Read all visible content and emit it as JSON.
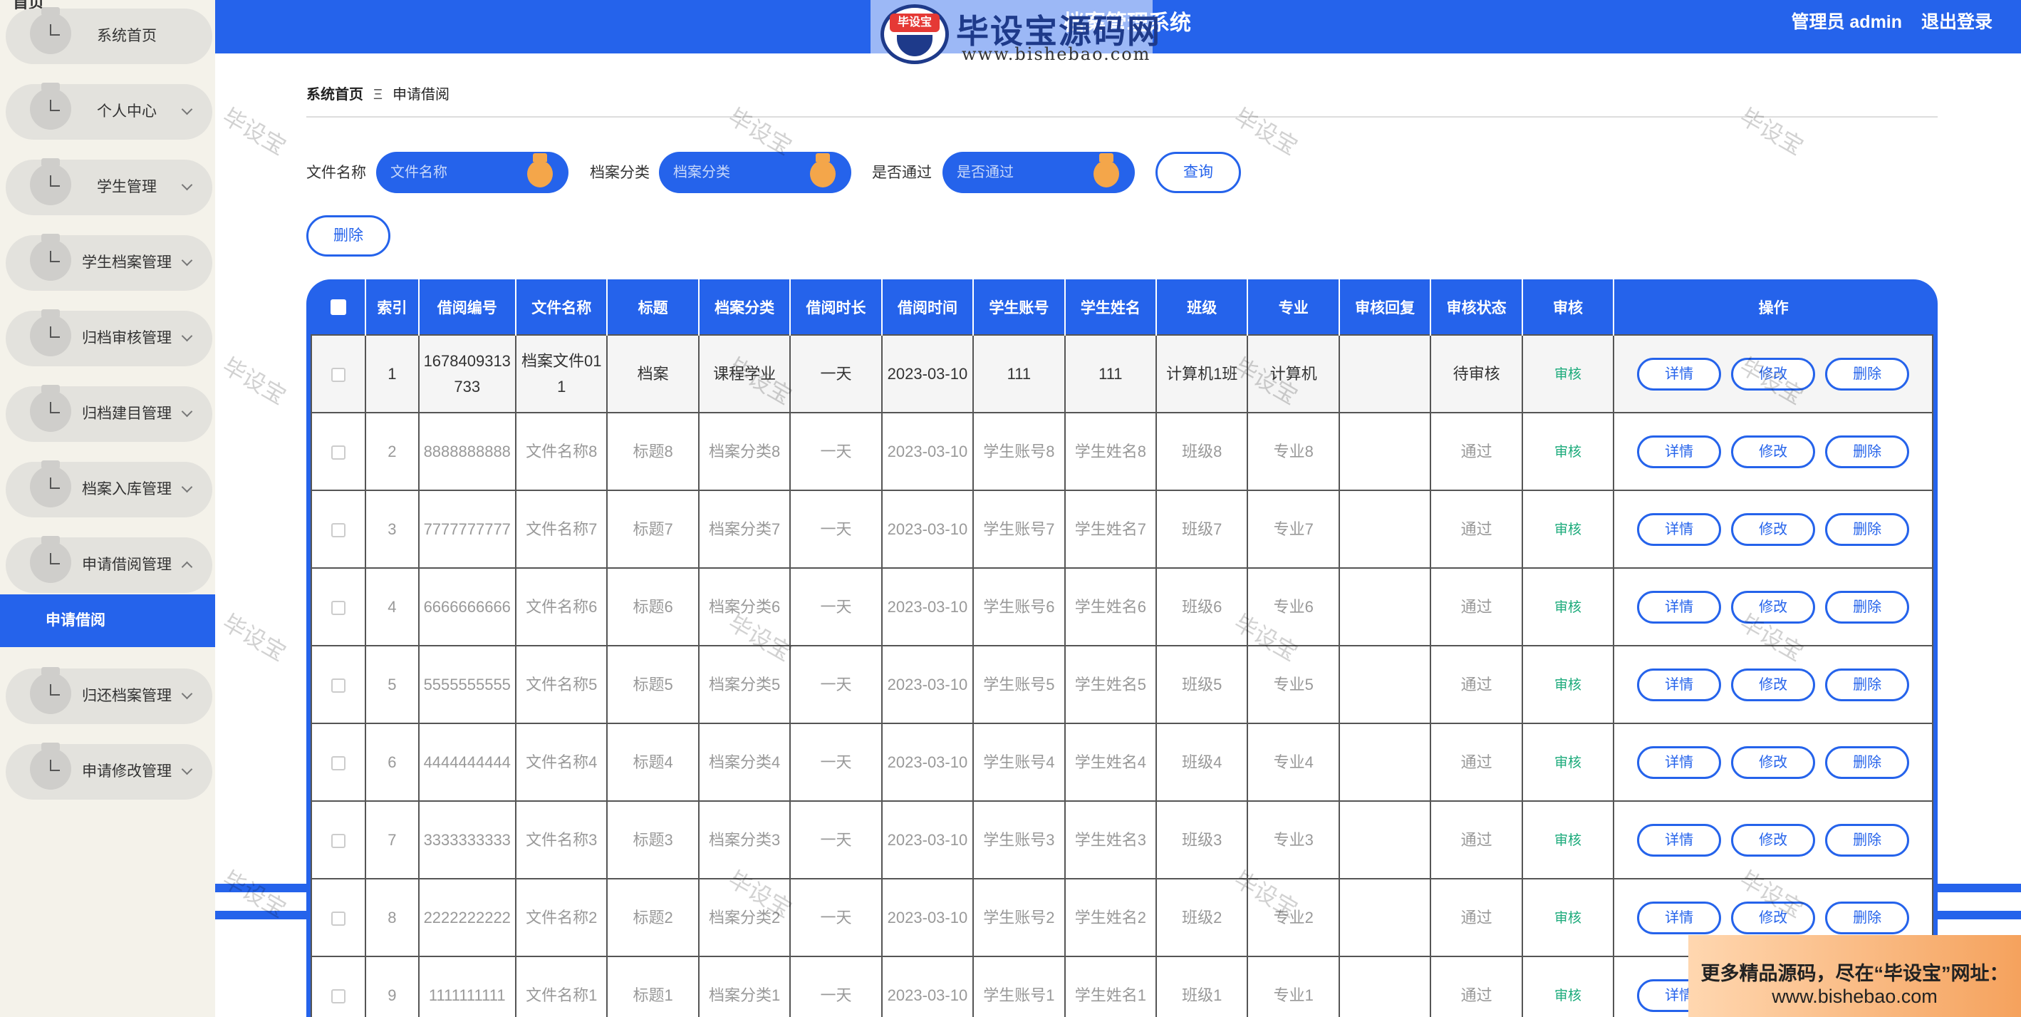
{
  "header": {
    "title": "档案管理系统",
    "user": "管理员 admin",
    "logout": "退出登录"
  },
  "sidebar": {
    "top_text": "首页",
    "items": [
      {
        "label": "系统首页",
        "has_children": false
      },
      {
        "label": "个人中心",
        "has_children": true
      },
      {
        "label": "学生管理",
        "has_children": true
      },
      {
        "label": "学生档案管理",
        "has_children": true
      },
      {
        "label": "归档审核管理",
        "has_children": true
      },
      {
        "label": "归档建目管理",
        "has_children": true
      },
      {
        "label": "档案入库管理",
        "has_children": true
      },
      {
        "label": "申请借阅管理",
        "has_children": true,
        "expanded": true
      },
      {
        "label": "归还档案管理",
        "has_children": true
      },
      {
        "label": "申请修改管理",
        "has_children": true
      }
    ],
    "active_sub": "申请借阅"
  },
  "breadcrumb": {
    "home": "系统首页",
    "sep": "Ξ",
    "current": "申请借阅"
  },
  "search": {
    "file_name_label": "文件名称",
    "file_name_placeholder": "文件名称",
    "category_label": "档案分类",
    "category_placeholder": "档案分类",
    "pass_label": "是否通过",
    "pass_placeholder": "是否通过",
    "query_button": "查询",
    "delete_button": "删除"
  },
  "table": {
    "columns": [
      "索引",
      "借阅编号",
      "文件名称",
      "标题",
      "档案分类",
      "借阅时长",
      "借阅时间",
      "学生账号",
      "学生姓名",
      "班级",
      "专业",
      "审核回复",
      "审核状态",
      "审核",
      "操作"
    ],
    "review_label": "审核",
    "detail_label": "详情",
    "edit_label": "修改",
    "delete_label": "删除",
    "rows": [
      {
        "idx": "1",
        "no": "1678409313733",
        "file": "档案文件011",
        "title": "档案",
        "cat": "课程学业",
        "dur": "一天",
        "time": "2023-03-10",
        "acct": "111",
        "name": "111",
        "cls": "计算机1班",
        "major": "计算机",
        "reply": "",
        "status": "待审核"
      },
      {
        "idx": "2",
        "no": "8888888888",
        "file": "文件名称8",
        "title": "标题8",
        "cat": "档案分类8",
        "dur": "一天",
        "time": "2023-03-10",
        "acct": "学生账号8",
        "name": "学生姓名8",
        "cls": "班级8",
        "major": "专业8",
        "reply": "",
        "status": "通过"
      },
      {
        "idx": "3",
        "no": "7777777777",
        "file": "文件名称7",
        "title": "标题7",
        "cat": "档案分类7",
        "dur": "一天",
        "time": "2023-03-10",
        "acct": "学生账号7",
        "name": "学生姓名7",
        "cls": "班级7",
        "major": "专业7",
        "reply": "",
        "status": "通过"
      },
      {
        "idx": "4",
        "no": "6666666666",
        "file": "文件名称6",
        "title": "标题6",
        "cat": "档案分类6",
        "dur": "一天",
        "time": "2023-03-10",
        "acct": "学生账号6",
        "name": "学生姓名6",
        "cls": "班级6",
        "major": "专业6",
        "reply": "",
        "status": "通过"
      },
      {
        "idx": "5",
        "no": "5555555555",
        "file": "文件名称5",
        "title": "标题5",
        "cat": "档案分类5",
        "dur": "一天",
        "time": "2023-03-10",
        "acct": "学生账号5",
        "name": "学生姓名5",
        "cls": "班级5",
        "major": "专业5",
        "reply": "",
        "status": "通过"
      },
      {
        "idx": "6",
        "no": "4444444444",
        "file": "文件名称4",
        "title": "标题4",
        "cat": "档案分类4",
        "dur": "一天",
        "time": "2023-03-10",
        "acct": "学生账号4",
        "name": "学生姓名4",
        "cls": "班级4",
        "major": "专业4",
        "reply": "",
        "status": "通过"
      },
      {
        "idx": "7",
        "no": "3333333333",
        "file": "文件名称3",
        "title": "标题3",
        "cat": "档案分类3",
        "dur": "一天",
        "time": "2023-03-10",
        "acct": "学生账号3",
        "name": "学生姓名3",
        "cls": "班级3",
        "major": "专业3",
        "reply": "",
        "status": "通过"
      },
      {
        "idx": "8",
        "no": "2222222222",
        "file": "文件名称2",
        "title": "标题2",
        "cat": "档案分类2",
        "dur": "一天",
        "time": "2023-03-10",
        "acct": "学生账号2",
        "name": "学生姓名2",
        "cls": "班级2",
        "major": "专业2",
        "reply": "",
        "status": "通过"
      },
      {
        "idx": "9",
        "no": "1111111111",
        "file": "文件名称1",
        "title": "标题1",
        "cat": "档案分类1",
        "dur": "一天",
        "time": "2023-03-10",
        "acct": "学生账号1",
        "name": "学生姓名1",
        "cls": "班级1",
        "major": "专业1",
        "reply": "",
        "status": "通过"
      }
    ]
  },
  "watermark": {
    "brand": "毕设宝源码网",
    "badge": "毕设宝",
    "url": "www.bishebao.com",
    "tile_text": "毕设宝",
    "ad_line1": "更多精品源码，尽在“毕设宝”网址：",
    "ad_line2": "www.bishebao.com"
  },
  "colors": {
    "primary": "#2563eb",
    "review_green": "#1aaa7a",
    "sidebar_bg": "#f4f2ea",
    "accent_orange": "#f4a64a"
  }
}
